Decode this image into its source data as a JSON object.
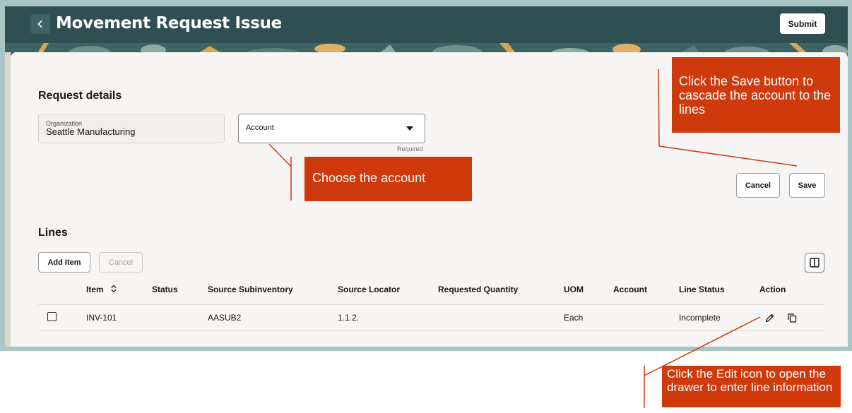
{
  "header": {
    "title": "Movement Request Issue",
    "submit_label": "Submit"
  },
  "request_details": {
    "section_title": "Request details",
    "organization_label": "Organization",
    "organization_value": "Seattle Manufacturing",
    "account_placeholder": "Account",
    "account_required": "Required",
    "cancel_label": "Cancel",
    "save_label": "Save"
  },
  "lines": {
    "section_title": "Lines",
    "add_item_label": "Add Item",
    "cancel_label": "Cancel",
    "columns": [
      "Item",
      "Status",
      "Source Subinventory",
      "Source Locator",
      "Requested Quantity",
      "UOM",
      "Account",
      "Line Status",
      "Action"
    ],
    "rows": [
      {
        "item": "INV-101",
        "status": "",
        "source_subinventory": "AASUB2",
        "source_locator": "1.1.2.",
        "requested_quantity": "",
        "uom": "Each",
        "account": "",
        "line_status": "Incomplete"
      }
    ]
  },
  "callouts": {
    "save": "Click the Save button to cascade the account to the lines",
    "account": "Choose the account",
    "edit": "Click the Edit icon to open the drawer to enter line information"
  },
  "colors": {
    "header_bg": "#2f4f52",
    "callout_bg": "#cf3a0c",
    "frame": "#a9c6c4"
  },
  "icons": {
    "back": "chevron-left-icon",
    "account_dropdown": "caret-down-icon",
    "sort": "sort-icon",
    "columns": "columns-icon",
    "edit": "pencil-icon",
    "duplicate": "copy-icon"
  }
}
